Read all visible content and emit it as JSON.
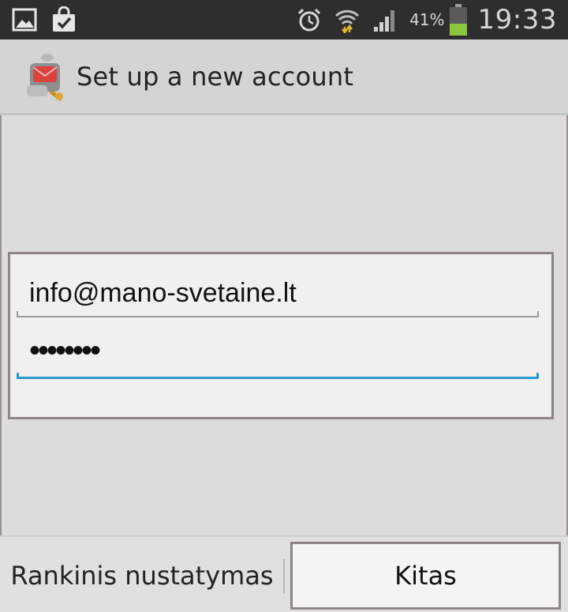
{
  "status_bar": {
    "left_icons": [
      "gallery-notification-icon",
      "shopping-bag-check-icon"
    ],
    "right_icons": [
      "alarm-icon",
      "wifi-icon",
      "signal-icon",
      "battery-icon"
    ],
    "battery_percent": "41%",
    "time": "19:33"
  },
  "action_bar": {
    "app_icon": "email-app-icon",
    "title": "Set up a new account"
  },
  "form": {
    "email_value": "info@mano-svetaine.lt",
    "password_value": "••••••••"
  },
  "buttons": {
    "manual_setup_label": "Rankinis nustatymas",
    "next_label": "Kitas"
  },
  "colors": {
    "status_bar_bg": "#2e2e2e",
    "focus_accent": "#2a9bd1",
    "battery_fill": "#8cc63f"
  }
}
